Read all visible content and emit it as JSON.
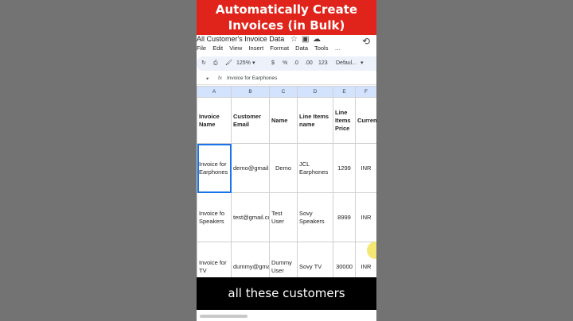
{
  "banner": {
    "line1": "Automatically Create",
    "line2": "Invoices (in Bulk)"
  },
  "doc": {
    "title": "All Customer's Invoice Data"
  },
  "menu": {
    "items": [
      "File",
      "Edit",
      "View",
      "Insert",
      "Format",
      "Data",
      "Tools"
    ]
  },
  "toolbar": {
    "zoom": "125%",
    "currency": "$",
    "percent": "%",
    "dec_down": ".0",
    "dec_up": ".00",
    "number": "123",
    "font": "Defaul..."
  },
  "formula": {
    "cell_ref": "",
    "fx": "fx",
    "value": "Invoice for Earphones"
  },
  "columns": [
    "A",
    "B",
    "C",
    "D",
    "E",
    "F"
  ],
  "headers": [
    "Invoice Name",
    "Customer Email",
    "Name",
    "Line Items name",
    "Line Items Price",
    "Curren"
  ],
  "rows": [
    [
      "Invoice for Earphones",
      "demo@gmail.com",
      "Demo",
      "JCL Earphones",
      "1299",
      "INR"
    ],
    [
      "Invoice fo Speakers",
      "test@gmail.com",
      "Test User",
      "Sovy Speakers",
      "8999",
      "INR"
    ],
    [
      "Invoice for TV",
      "dummy@gmail.com",
      "Dummy User",
      "Sovy TV",
      "30000",
      "INR"
    ]
  ],
  "caption": "all these customers",
  "colors": {
    "banner": "#e0241b",
    "header_row": "#d3e3fd",
    "selection": "#1a73e8"
  }
}
